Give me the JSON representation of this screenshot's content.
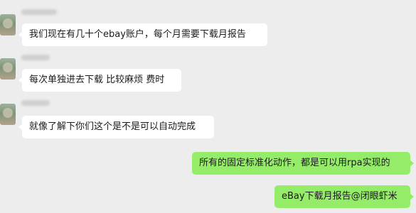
{
  "messages": [
    {
      "side": "in",
      "text": "我们现在有几十个ebay账户，每个月需要下载月报告"
    },
    {
      "side": "in",
      "text": "每次单独进去下载 比较麻烦 费时"
    },
    {
      "side": "in",
      "text": "就像了解下你们这个是不是可以自动完成"
    },
    {
      "side": "out",
      "text": "所有的固定标准化动作，都是可以用rpa实现的"
    },
    {
      "side": "out",
      "text": "eBay下载月报告@闭眼虾米"
    }
  ],
  "colors": {
    "background": "#ededed",
    "incoming_bubble": "#ffffff",
    "outgoing_bubble": "#95ec69"
  }
}
